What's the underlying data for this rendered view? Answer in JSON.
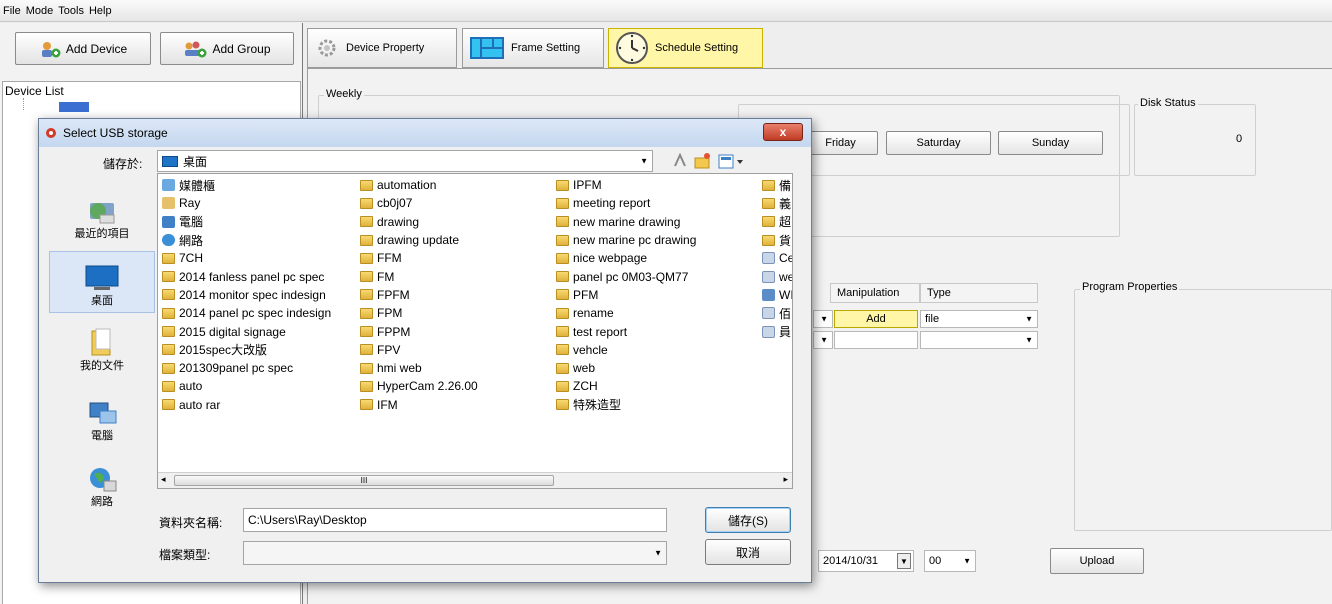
{
  "menu": [
    "File",
    "Mode",
    "Tools",
    "Help"
  ],
  "left": {
    "add_device": "Add Device",
    "add_group": "Add Group",
    "device_list": "Device List"
  },
  "tabs": [
    "Device Property",
    "Frame Setting",
    "Schedule Setting"
  ],
  "schedule": {
    "weekly_label": "Weekly",
    "days": [
      "Friday",
      "Saturday",
      "Sunday"
    ],
    "disk_status_label": "Disk Status",
    "disk_status_value": "0",
    "grid_headers": [
      "Manipulation",
      "Type"
    ],
    "row1_manipulation": "Add",
    "row1_type": "file",
    "program_properties_label": "Program Properties",
    "date_value": "2014/10/31",
    "hour_value": "00",
    "upload_label": "Upload"
  },
  "dialog": {
    "title": "Select USB storage",
    "close": "x",
    "save_in_label": "儲存於:",
    "save_in_value": "桌面",
    "places": [
      "最近的項目",
      "桌面",
      "我的文件",
      "電腦",
      "網路"
    ],
    "files_col1": [
      "媒體櫃",
      "Ray",
      "電腦",
      "網路",
      "7CH",
      "2014 fanless panel pc spec",
      "2014 monitor spec indesign",
      "2014 panel pc spec indesign",
      "2015 digital signage",
      "2015spec大改版",
      "201309panel pc spec",
      "auto",
      "auto rar"
    ],
    "files_col2": [
      "automation",
      "cb0j07",
      "drawing",
      "drawing update",
      "FFM",
      "FM",
      "FPFM",
      "FPM",
      "FPPM",
      "FPV",
      "hmi web",
      "HyperCam 2.26.00",
      "IFM"
    ],
    "files_col3": [
      "IPFM",
      "meeting report",
      "new marine drawing",
      "new marine pc drawing",
      "nice webpage",
      "panel pc 0M03-QM77",
      "PFM",
      "rename",
      "test report",
      "vehcle",
      "web",
      "ZCH",
      "特殊造型"
    ],
    "files_col4": [
      "備",
      "義",
      "超",
      "貨",
      "Ce",
      "we",
      "WI",
      "佰",
      "員"
    ],
    "scroll_glyph": "III",
    "folder_name_label": "資料夾名稱:",
    "folder_name_value": "C:\\Users\\Ray\\Desktop",
    "file_type_label": "檔案類型:",
    "save_button": "儲存(S)",
    "cancel_button": "取消"
  }
}
